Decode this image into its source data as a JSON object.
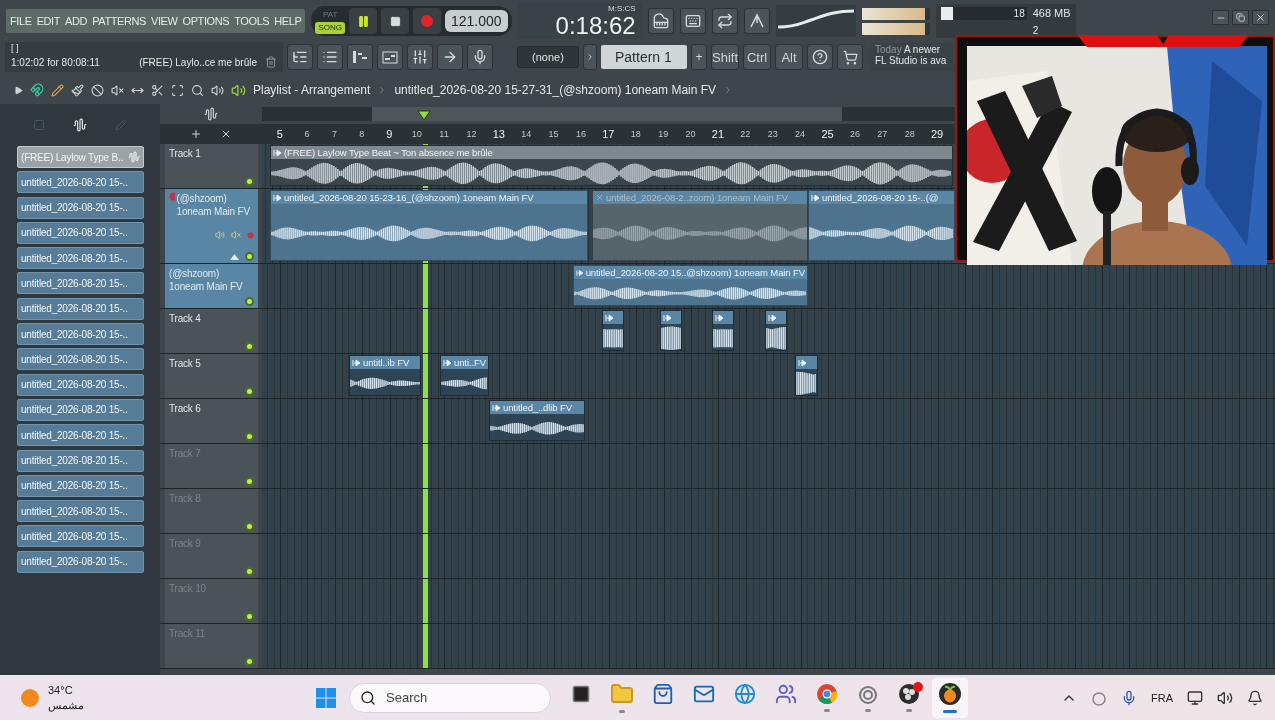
{
  "menu": [
    "FILE",
    "EDIT",
    "ADD",
    "PATTERNS",
    "VIEW",
    "OPTIONS",
    "TOOLS",
    "HELP"
  ],
  "transport": {
    "modes": [
      {
        "label": "PAT",
        "selected": false
      },
      {
        "label": "SONG",
        "selected": true
      }
    ],
    "playing": true,
    "tempo": "121.000"
  },
  "time": {
    "value": "0:18:62",
    "format": "M:S:CS"
  },
  "meters": [
    {
      "level": 0.93
    },
    {
      "level": 0.93
    }
  ],
  "performance": {
    "cpu": "18",
    "cpu_meter": {
      "level": 0.14
    },
    "memory": "468 MB",
    "voices": "2"
  },
  "hint": {
    "bracket": "[ ]",
    "position": "1:02:02 for 80:08:11",
    "item": "(FREE) Laylo..ce me brûle"
  },
  "pattern": {
    "channel": "(none)",
    "name": "Pattern 1",
    "add": "+"
  },
  "modifiers": [
    "Shift",
    "Ctrl",
    "Alt"
  ],
  "news": {
    "date": "Today",
    "line1": "A newer",
    "line2": "FL Studio is ava"
  },
  "playlist": {
    "title": "Playlist - Arrangement",
    "arrangement": "untitled_2026-08-20 15-27-31_(@shzoom) 1oneam Main FV"
  },
  "browser": [
    {
      "label": "(FREE) Laylow Type B..",
      "selected": true
    },
    {
      "label": "untitled_2026-08-20 15-..",
      "selected": false
    },
    {
      "label": "untitled_2026-08-20 15-..",
      "selected": false
    },
    {
      "label": "untitled_2026-08-20 15-..",
      "selected": false
    },
    {
      "label": "untitled_2026-08-20 15-..",
      "selected": false
    },
    {
      "label": "untitled_2026-08-20 15-..",
      "selected": false
    },
    {
      "label": "untitled_2026-08-20 15-..",
      "selected": false
    },
    {
      "label": "untitled_2026-08-20 15-..",
      "selected": false
    },
    {
      "label": "untitled_2026-08-20 15-..",
      "selected": false
    },
    {
      "label": "untitled_2026-08-20 15-..",
      "selected": false
    },
    {
      "label": "untitled_2026-08-20 15-..",
      "selected": false
    },
    {
      "label": "untitled_2026-08-20 15-..",
      "selected": false
    },
    {
      "label": "untitled_2026-08-20 15-..",
      "selected": false
    },
    {
      "label": "untitled_2026-08-20 15-..",
      "selected": false
    },
    {
      "label": "untitled_2026-08-20 15-..",
      "selected": false
    },
    {
      "label": "untitled_2026-08-20 15-..",
      "selected": false
    },
    {
      "label": "untitled_2026-08-20 15-..",
      "selected": false
    }
  ],
  "ruler": [
    "5",
    "6",
    "7",
    "8",
    "9",
    "10",
    "11",
    "12",
    "13",
    "14",
    "15",
    "16",
    "17",
    "18",
    "19",
    "20",
    "21",
    "22",
    "23",
    "24",
    "25",
    "26",
    "27",
    "28",
    "29"
  ],
  "tracks": [
    {
      "name": "Track 1",
      "selected": false,
      "dim": false,
      "expanded": false,
      "clips": [
        {
          "label": "(FREE) Laylow Type Beat ~ Ton absence me brûle",
          "muted": false,
          "color": "#7e888d"
        }
      ]
    },
    {
      "name": "(@shzoom) 1oneam Main FV",
      "selected": true,
      "dim": false,
      "expanded": true,
      "clips": [
        {
          "label": "untitled_2026-08-20 15-23-16_(@shzoom) 1oneam Main FV",
          "muted": false,
          "color": "#5b87a7"
        },
        {
          "label": "untitled_2026-08-2..zoom) 1oneam Main FV",
          "muted": true,
          "color": "#5b87a7"
        },
        {
          "label": "untitled_2026-08-20 15-..(@",
          "muted": false,
          "color": "#5b87a7"
        }
      ]
    },
    {
      "name": "(@shzoom) 1oneam Main FV",
      "selected": true,
      "dim": false,
      "expanded": false,
      "clips": [
        {
          "label": "untitled_2026-08-20 15..@shzoom) 1oneam Main FV",
          "muted": false,
          "color": "#5b87a7"
        }
      ]
    },
    {
      "name": "Track 4",
      "selected": false,
      "dim": false,
      "expanded": false,
      "clips": [
        {
          "muted": false,
          "color": "#5b87a7"
        },
        {
          "muted": false,
          "color": "#5b87a7"
        },
        {
          "muted": false,
          "color": "#5b87a7"
        },
        {
          "muted": false,
          "color": "#5b87a7"
        }
      ]
    },
    {
      "name": "Track 5",
      "selected": false,
      "dim": false,
      "expanded": false,
      "clips": [
        {
          "label": "untitl..ib FV",
          "muted": false,
          "color": "#5b87a7"
        },
        {
          "label": "unti..FV",
          "muted": false,
          "color": "#5b87a7"
        },
        {
          "muted": false,
          "color": "#5b87a7"
        }
      ]
    },
    {
      "name": "Track 6",
      "selected": false,
      "dim": false,
      "expanded": false,
      "clips": [
        {
          "label": "untitled_..dlib FV",
          "muted": false,
          "color": "#5b87a7"
        }
      ]
    },
    {
      "name": "Track 7",
      "selected": false,
      "dim": true,
      "expanded": false
    },
    {
      "name": "Track 8",
      "selected": false,
      "dim": true,
      "expanded": false
    },
    {
      "name": "Track 9",
      "selected": false,
      "dim": true,
      "expanded": false
    },
    {
      "name": "Track 10",
      "selected": false,
      "dim": true,
      "expanded": false
    },
    {
      "name": "Track 11",
      "selected": false,
      "dim": true,
      "expanded": false
    }
  ],
  "taskbar": {
    "weather": {
      "temperature": "34°C",
      "condition": "مشمس"
    },
    "search": {
      "placeholder": "Search"
    },
    "apps": [
      {
        "running": false,
        "active": false,
        "badge": false
      },
      {
        "running": true,
        "active": false,
        "badge": false
      },
      {
        "running": false,
        "active": false,
        "badge": false
      },
      {
        "running": false,
        "active": false,
        "badge": false
      },
      {
        "running": false,
        "active": false,
        "badge": false
      },
      {
        "running": false,
        "active": false,
        "badge": false
      },
      {
        "running": true,
        "active": false,
        "badge": false
      },
      {
        "running": true,
        "active": false,
        "badge": false
      },
      {
        "running": true,
        "active": false,
        "badge": true
      },
      {
        "running": true,
        "active": true,
        "badge": false
      }
    ],
    "language": "FRA"
  }
}
